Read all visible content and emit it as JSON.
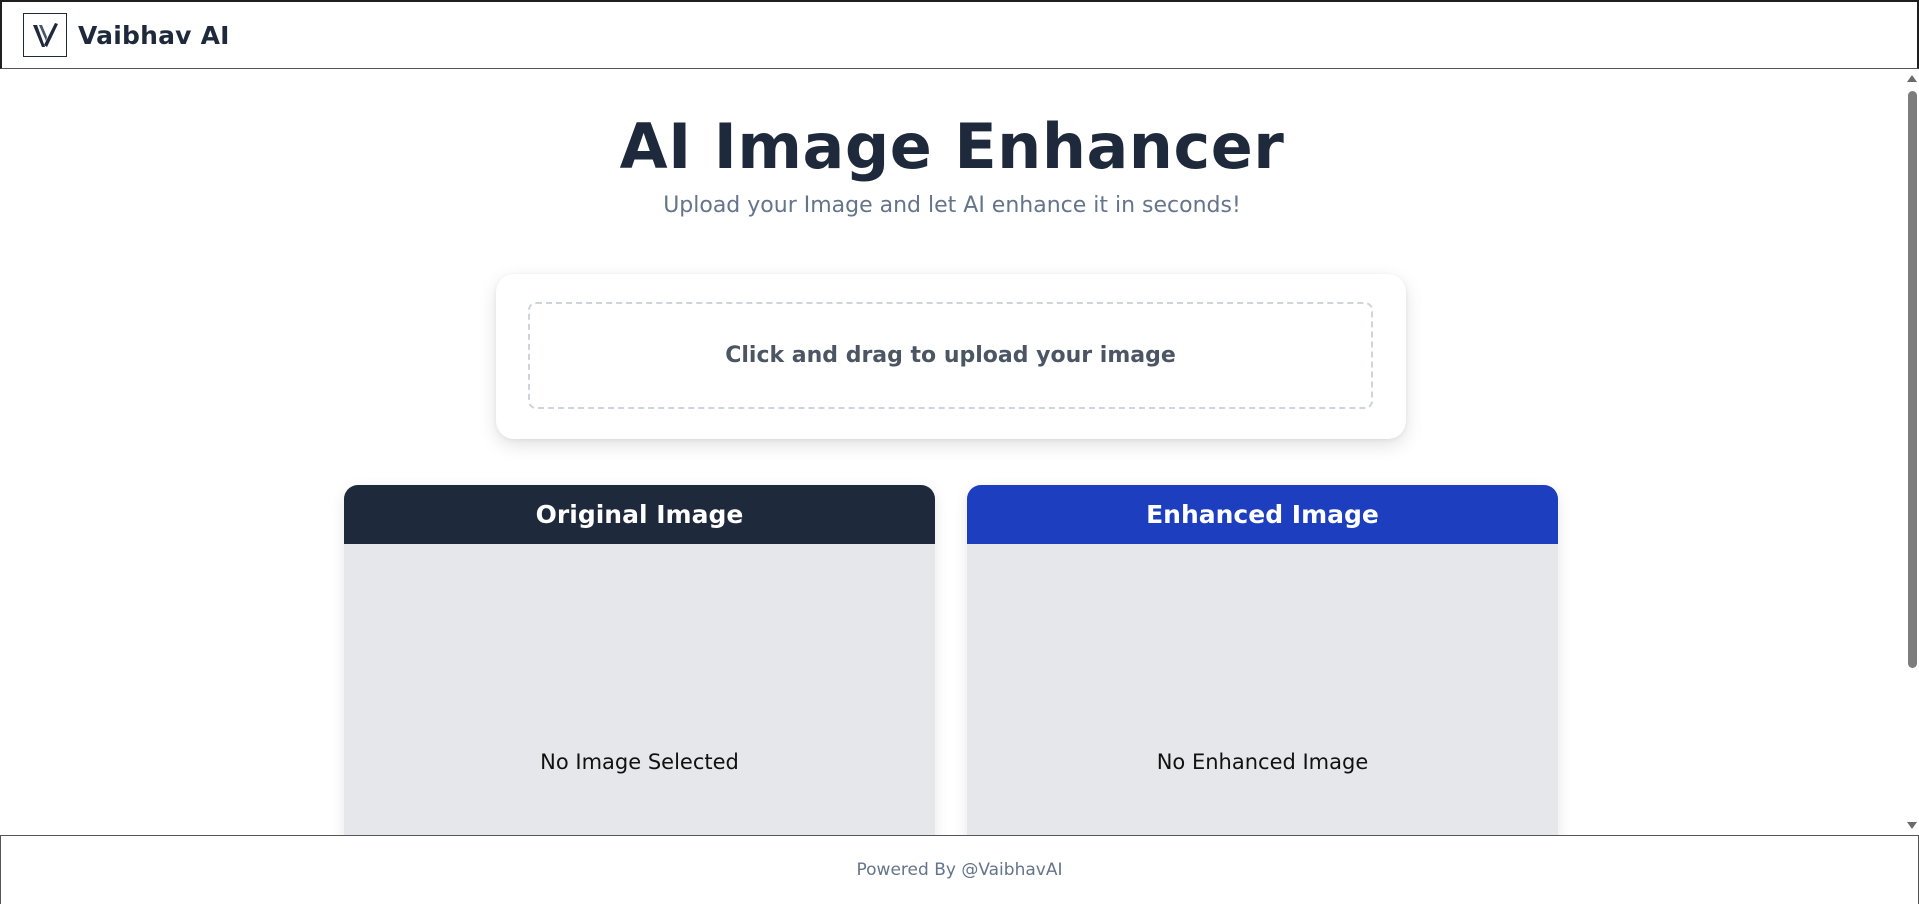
{
  "navbar": {
    "brand": "Vaibhav AI",
    "logo_icon": "v-logo-icon"
  },
  "hero": {
    "title": "AI Image Enhancer",
    "subtitle": "Upload your Image and let AI enhance it in seconds!"
  },
  "upload": {
    "label": "Click and drag to upload your image"
  },
  "panels": {
    "original": {
      "title": "Original Image",
      "empty_text": "No Image Selected",
      "header_color": "#1e293b"
    },
    "enhanced": {
      "title": "Enhanced Image",
      "empty_text": "No Enhanced Image",
      "header_color": "#1d3fbf"
    }
  },
  "footer": {
    "text": "Powered By @VaibhavAI"
  }
}
